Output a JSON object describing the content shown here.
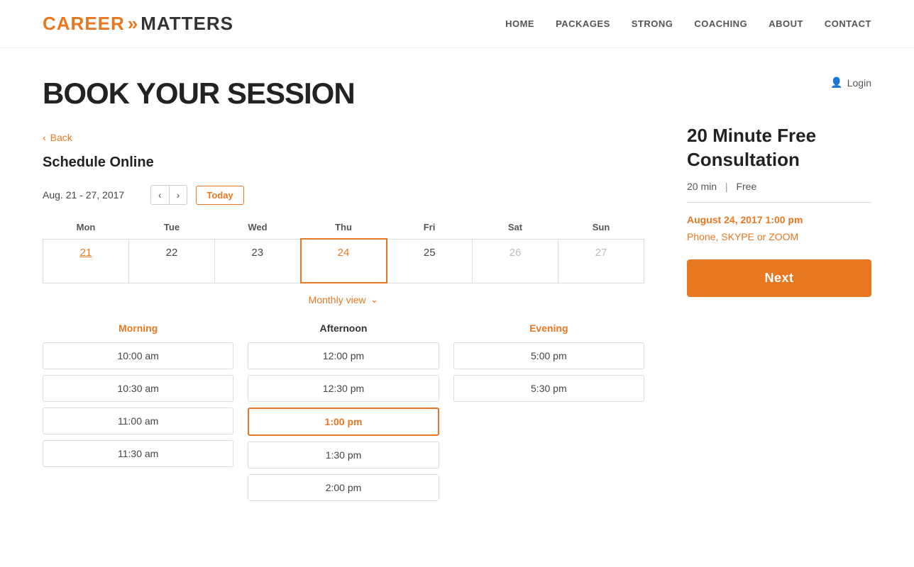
{
  "header": {
    "logo": {
      "career": "CAREER",
      "arrows": "»",
      "matters": "MATTERS"
    },
    "nav": [
      {
        "label": "HOME",
        "active": false
      },
      {
        "label": "PACKAGES",
        "active": false
      },
      {
        "label": "STRONG",
        "active": false
      },
      {
        "label": "COACHING",
        "active": false
      },
      {
        "label": "ABOUT",
        "active": false
      },
      {
        "label": "CONTACT",
        "active": false
      }
    ]
  },
  "page": {
    "title": "BOOK YOUR SESSION",
    "back_label": "Back",
    "schedule_title": "Schedule Online",
    "login_label": "Login"
  },
  "calendar": {
    "date_range": "Aug. 21 - 27, 2017",
    "today_label": "Today",
    "days": [
      "Mon",
      "Tue",
      "Wed",
      "Thu",
      "Fri",
      "Sat",
      "Sun"
    ],
    "dates": [
      {
        "num": "21",
        "type": "current-link"
      },
      {
        "num": "22",
        "type": "normal"
      },
      {
        "num": "23",
        "type": "normal"
      },
      {
        "num": "24",
        "type": "today"
      },
      {
        "num": "25",
        "type": "normal"
      },
      {
        "num": "26",
        "type": "grayed"
      },
      {
        "num": "27",
        "type": "grayed"
      }
    ],
    "monthly_view_label": "Monthly view"
  },
  "time_slots": {
    "morning": {
      "title": "Morning",
      "slots": [
        "10:00 am",
        "10:30 am",
        "11:00 am",
        "11:30 am"
      ]
    },
    "afternoon": {
      "title": "Afternoon",
      "slots": [
        "12:00 pm",
        "12:30 pm",
        "1:00 pm",
        "1:30 pm",
        "2:00 pm"
      ]
    },
    "evening": {
      "title": "Evening",
      "slots": [
        "5:00 pm",
        "5:30 pm"
      ]
    }
  },
  "consultation": {
    "title": "20 Minute Free Consultation",
    "duration": "20 min",
    "price": "Free",
    "datetime": "August 24, 2017 1:00 pm",
    "location": "Phone, SKYPE or ZOOM",
    "next_label": "Next"
  }
}
